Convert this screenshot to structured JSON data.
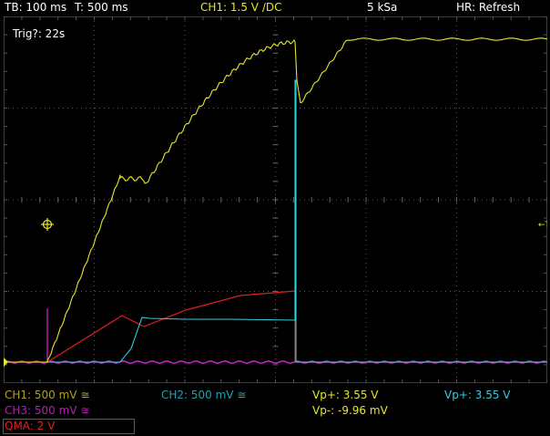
{
  "header": {
    "timebase": "TB: 100 ms",
    "trigger_pos": "T: 500 ms",
    "ch1_setting": "CH1: 1.5 V ∕DC",
    "sample_rate": "5 kSa",
    "mode": "HR: Refresh"
  },
  "status": {
    "trig": "Trig?: 22s"
  },
  "channels": {
    "ch1": {
      "label": "CH1: 500 mV ≅",
      "color": "#e6e62a"
    },
    "ch2": {
      "label": "CH2: 500 mV ≅",
      "color": "#30d0e0"
    },
    "ch3": {
      "label": "CH3: 500 mV ≅",
      "color": "#e020e0"
    },
    "qma": {
      "label": "QMA: 2 V",
      "color": "#e02020"
    }
  },
  "measurements": {
    "ch1_vp_plus": "Vp+: 3.55 V",
    "ch1_vp_minus": "Vp-: -9.96 mV",
    "ch2_vp_plus": "Vp+: 3.55 V"
  },
  "markers": {
    "trigger_right": "←T"
  }
}
